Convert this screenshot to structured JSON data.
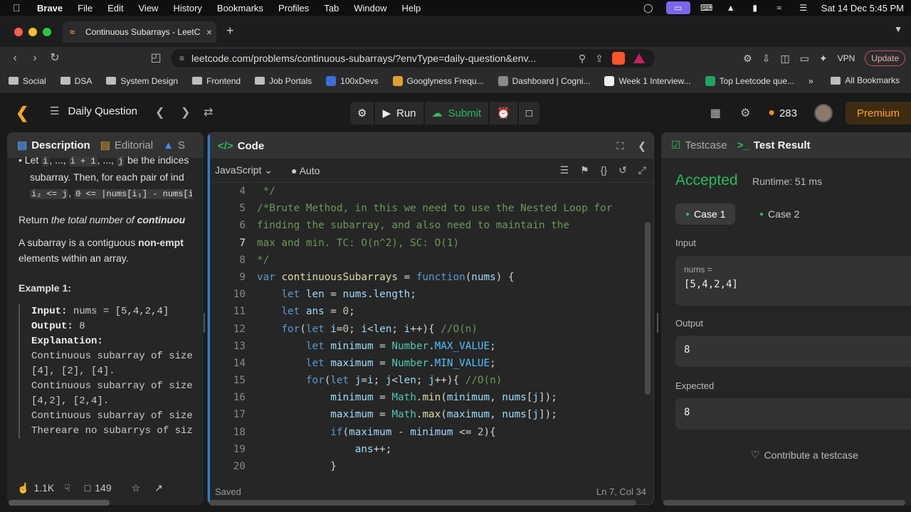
{
  "menubar": {
    "app": "Brave",
    "items": [
      "File",
      "Edit",
      "View",
      "History",
      "Bookmarks",
      "Profiles",
      "Tab",
      "Window",
      "Help"
    ],
    "clock": "Sat 14 Dec  5:45 PM"
  },
  "browser": {
    "tab_title": "Continuous Subarrays - LeetC",
    "url": "leetcode.com/problems/continuous-subarrays/?envType=daily-question&env...",
    "vpn_label": "VPN",
    "update_label": "Update",
    "bookmarks": [
      "Social",
      "DSA",
      "System Design",
      "Frontend",
      "Job Portals",
      "100xDevs",
      "Googlyness Frequ...",
      "Dashboard | Cogni...",
      "Week 1 Interview...",
      "Top Leetcode que..."
    ],
    "all_bookmarks": "All Bookmarks",
    "more": "»"
  },
  "lc": {
    "daily_question": "Daily Question",
    "run": "Run",
    "submit": "Submit",
    "streak": "283",
    "premium": "Premium"
  },
  "description": {
    "tabs": [
      "Description",
      "Editorial",
      "S"
    ],
    "line1a": "Let ",
    "line1b": "be the indices i",
    "line2": "subarray. Then, for each pair of ind",
    "inline_codes": [
      "i",
      "i + 1",
      "j",
      "i₂ <= j",
      "0 <= |nums[i₁] - nums[i"
    ],
    "sep": ", ..., ",
    "return_a": "Return ",
    "return_b": "the total number of ",
    "return_c": "continuou",
    "sub_a": "A subarray is a contiguous ",
    "sub_b": "non-empt",
    "sub_c": "elements within an array.",
    "example_title": "Example 1:",
    "input_label": "Input:",
    "input_value": " nums = [5,4,2,4]",
    "output_label": "Output:",
    "output_value": " 8",
    "explanation_label": "Explanation:",
    "explanation_lines": [
      "Continuous subarray of size",
      "[4], [2], [4].",
      "Continuous subarray of size",
      "[4,2], [2,4].",
      "Continuous subarray of size",
      "Thereare no subarrys of siz"
    ],
    "likes": "1.1K",
    "comments": "149"
  },
  "code": {
    "tab": "Code",
    "language": "JavaScript",
    "mode": "Auto",
    "saved": "Saved",
    "cursor": "Ln 7, Col 34",
    "current_line": 7,
    "lines": [
      {
        "n": 4,
        "t": [
          [
            "c-com",
            " */"
          ]
        ]
      },
      {
        "n": 5,
        "t": [
          [
            "c-com",
            "/*Brute Method, in this we need to use the Nested Loop for"
          ]
        ]
      },
      {
        "n": 6,
        "t": [
          [
            "c-com",
            "finding the subarray, and also need to maintain the"
          ]
        ]
      },
      {
        "n": 7,
        "t": [
          [
            "c-com",
            "max and min. TC: O(n^2), SC: O(1)"
          ]
        ]
      },
      {
        "n": 8,
        "t": [
          [
            "c-com",
            "*/"
          ]
        ]
      },
      {
        "n": 9,
        "t": [
          [
            "c-kw",
            "var "
          ],
          [
            "c-fn",
            "continuousSubarrays"
          ],
          [
            "",
            " = "
          ],
          [
            "c-kw",
            "function"
          ],
          [
            "",
            "("
          ],
          [
            "c-var",
            "nums"
          ],
          [
            "",
            ") {"
          ]
        ]
      },
      {
        "n": 10,
        "t": [
          [
            "",
            "    "
          ],
          [
            "c-kw",
            "let "
          ],
          [
            "c-var",
            "len"
          ],
          [
            "",
            " = "
          ],
          [
            "c-var",
            "nums"
          ],
          [
            "",
            "."
          ],
          [
            "c-var",
            "length"
          ],
          [
            "",
            ";"
          ]
        ]
      },
      {
        "n": 11,
        "t": [
          [
            "",
            "    "
          ],
          [
            "c-kw",
            "let "
          ],
          [
            "c-var",
            "ans"
          ],
          [
            "",
            " = "
          ],
          [
            "c-num",
            "0"
          ],
          [
            "",
            ";"
          ]
        ]
      },
      {
        "n": 12,
        "t": [
          [
            "",
            "    "
          ],
          [
            "c-kw",
            "for"
          ],
          [
            "",
            "("
          ],
          [
            "c-kw",
            "let "
          ],
          [
            "c-var",
            "i"
          ],
          [
            "",
            "="
          ],
          [
            "c-num",
            "0"
          ],
          [
            "",
            "; "
          ],
          [
            "c-var",
            "i"
          ],
          [
            "",
            "<"
          ],
          [
            "c-var",
            "len"
          ],
          [
            "",
            "; "
          ],
          [
            "c-var",
            "i"
          ],
          [
            "",
            "++){ "
          ],
          [
            "c-com",
            "//O(n)"
          ]
        ]
      },
      {
        "n": 13,
        "t": [
          [
            "",
            "        "
          ],
          [
            "c-kw",
            "let "
          ],
          [
            "c-var",
            "minimum"
          ],
          [
            "",
            " = "
          ],
          [
            "c-cls",
            "Number"
          ],
          [
            "",
            "."
          ],
          [
            "c-prop",
            "MAX_VALUE"
          ],
          [
            "",
            ";"
          ]
        ]
      },
      {
        "n": 14,
        "t": [
          [
            "",
            "        "
          ],
          [
            "c-kw",
            "let "
          ],
          [
            "c-var",
            "maximum"
          ],
          [
            "",
            " = "
          ],
          [
            "c-cls",
            "Number"
          ],
          [
            "",
            "."
          ],
          [
            "c-prop",
            "MIN_VALUE"
          ],
          [
            "",
            ";"
          ]
        ]
      },
      {
        "n": 15,
        "t": [
          [
            "",
            "        "
          ],
          [
            "c-kw",
            "for"
          ],
          [
            "",
            "("
          ],
          [
            "c-kw",
            "let "
          ],
          [
            "c-var",
            "j"
          ],
          [
            "",
            "="
          ],
          [
            "c-var",
            "i"
          ],
          [
            "",
            "; "
          ],
          [
            "c-var",
            "j"
          ],
          [
            "",
            "<"
          ],
          [
            "c-var",
            "len"
          ],
          [
            "",
            "; "
          ],
          [
            "c-var",
            "j"
          ],
          [
            "",
            "++){ "
          ],
          [
            "c-com",
            "//O(n)"
          ]
        ]
      },
      {
        "n": 16,
        "t": [
          [
            "",
            "            "
          ],
          [
            "c-var",
            "minimum"
          ],
          [
            "",
            " = "
          ],
          [
            "c-cls",
            "Math"
          ],
          [
            "",
            "."
          ],
          [
            "c-fn",
            "min"
          ],
          [
            "",
            "("
          ],
          [
            "c-var",
            "minimum"
          ],
          [
            "",
            ", "
          ],
          [
            "c-var",
            "nums"
          ],
          [
            "",
            "["
          ],
          [
            "c-var",
            "j"
          ],
          [
            "",
            "]);"
          ]
        ]
      },
      {
        "n": 17,
        "t": [
          [
            "",
            "            "
          ],
          [
            "c-var",
            "maximum"
          ],
          [
            "",
            " = "
          ],
          [
            "c-cls",
            "Math"
          ],
          [
            "",
            "."
          ],
          [
            "c-fn",
            "max"
          ],
          [
            "",
            "("
          ],
          [
            "c-var",
            "maximum"
          ],
          [
            "",
            ", "
          ],
          [
            "c-var",
            "nums"
          ],
          [
            "",
            "["
          ],
          [
            "c-var",
            "j"
          ],
          [
            "",
            "]);"
          ]
        ]
      },
      {
        "n": 18,
        "t": [
          [
            "",
            "            "
          ],
          [
            "c-kw",
            "if"
          ],
          [
            "",
            "("
          ],
          [
            "c-var",
            "maximum"
          ],
          [
            "",
            " - "
          ],
          [
            "c-var",
            "minimum"
          ],
          [
            "",
            " <= "
          ],
          [
            "c-num",
            "2"
          ],
          [
            "",
            "){"
          ]
        ]
      },
      {
        "n": 19,
        "t": [
          [
            "",
            "                "
          ],
          [
            "c-var",
            "ans"
          ],
          [
            "",
            "++;"
          ]
        ]
      },
      {
        "n": 20,
        "t": [
          [
            "",
            "            }"
          ]
        ]
      }
    ]
  },
  "result": {
    "tabs": [
      "Testcase",
      "Test Result"
    ],
    "status": "Accepted",
    "runtime": "Runtime: 51 ms",
    "cases": [
      "Case 1",
      "Case 2"
    ],
    "input_label": "Input",
    "input_name": "nums =",
    "input_value": "[5,4,2,4]",
    "output_label": "Output",
    "output_value": "8",
    "expected_label": "Expected",
    "expected_value": "8",
    "contribute": "Contribute a testcase"
  }
}
